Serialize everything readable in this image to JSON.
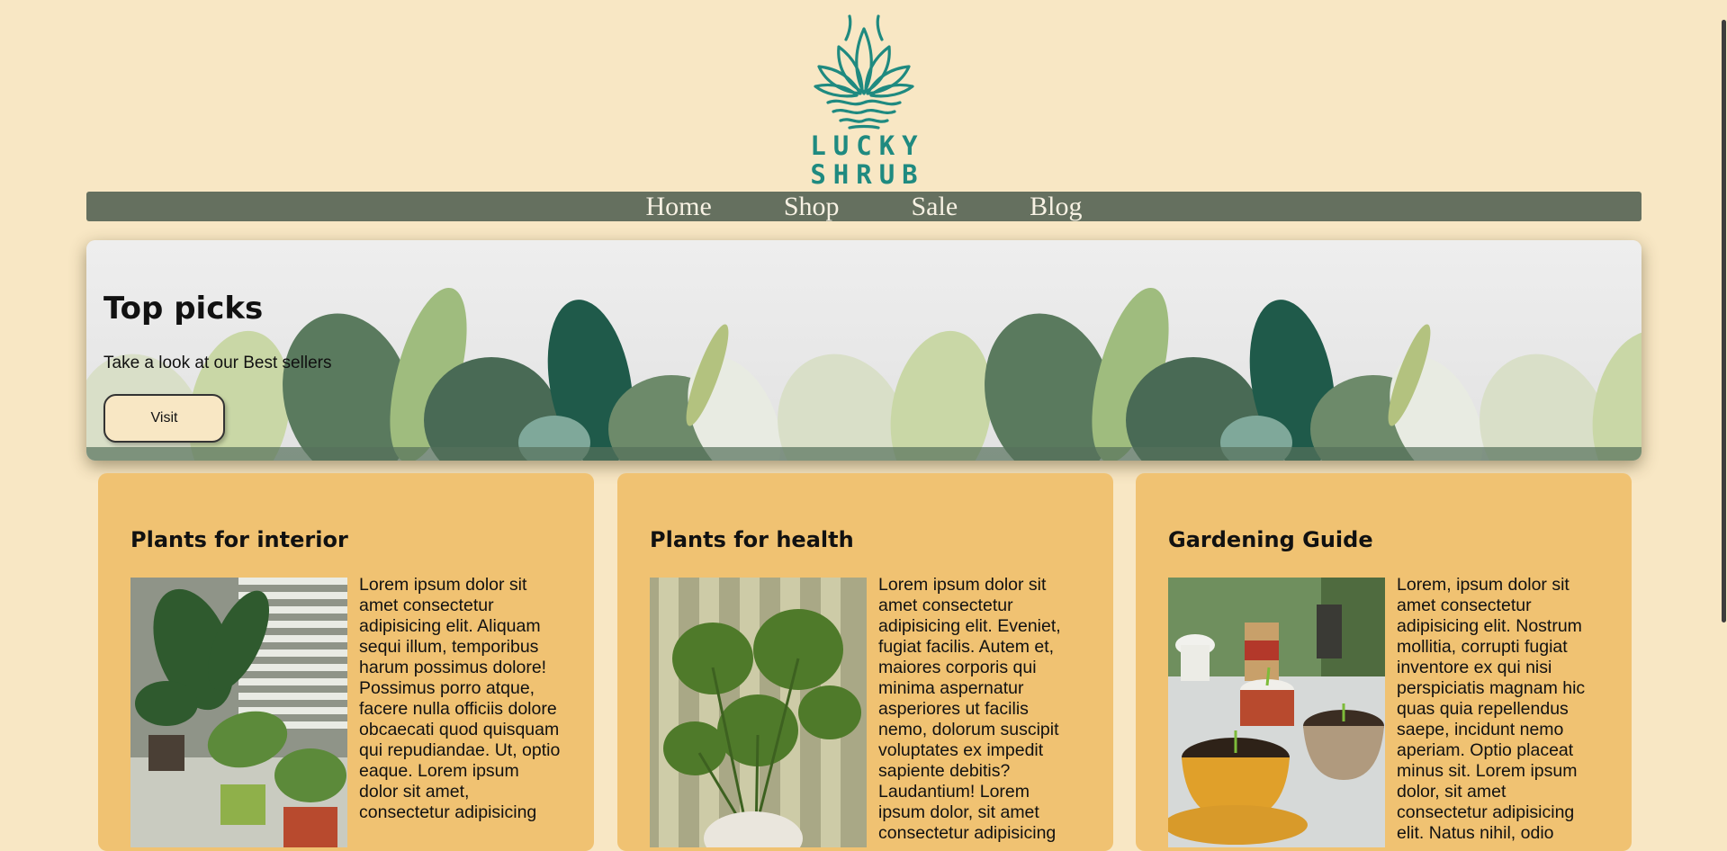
{
  "brand": {
    "line1": "LUCKY",
    "line2": "SHRUB"
  },
  "nav": {
    "items": [
      "Home",
      "Shop",
      "Sale",
      "Blog"
    ]
  },
  "hero": {
    "title": "Top picks",
    "subtitle": "Take a look at our Best sellers",
    "button_label": "Visit"
  },
  "cards": [
    {
      "title": "Plants for interior",
      "text": "Lorem ipsum dolor sit amet consectetur adipisicing elit. Aliquam sequi illum, temporibus harum possimus dolore! Possimus porro atque, facere nulla officiis dolore obcaecati quod quisquam qui repudiandae. Ut, optio eaque. Lorem ipsum dolor sit amet, consectetur adipisicing"
    },
    {
      "title": "Plants for health",
      "text": "Lorem ipsum dolor sit amet consectetur adipisicing elit. Eveniet, fugiat facilis. Autem et, maiores corporis qui minima aspernatur asperiores ut facilis nemo, dolorum suscipit voluptates ex impedit sapiente debitis? Laudantium! Lorem ipsum dolor, sit amet consectetur adipisicing"
    },
    {
      "title": "Gardening Guide",
      "text": "Lorem, ipsum dolor sit amet consectetur adipisicing elit. Nostrum mollitia, corrupti fugiat inventore ex qui nisi perspiciatis magnam hic quas quia repellendus saepe, incidunt nemo aperiam. Optio placeat minus sit. Lorem ipsum dolor, sit amet consectetur adipisicing elit. Natus nihil, odio"
    }
  ],
  "colors": {
    "page_bg": "#f8e7c4",
    "nav_bg": "#65705f",
    "card_bg": "#f0c272",
    "brand_teal": "#1f8a80"
  },
  "icons": {
    "logo": "lucky-shrub-plant-logo"
  }
}
